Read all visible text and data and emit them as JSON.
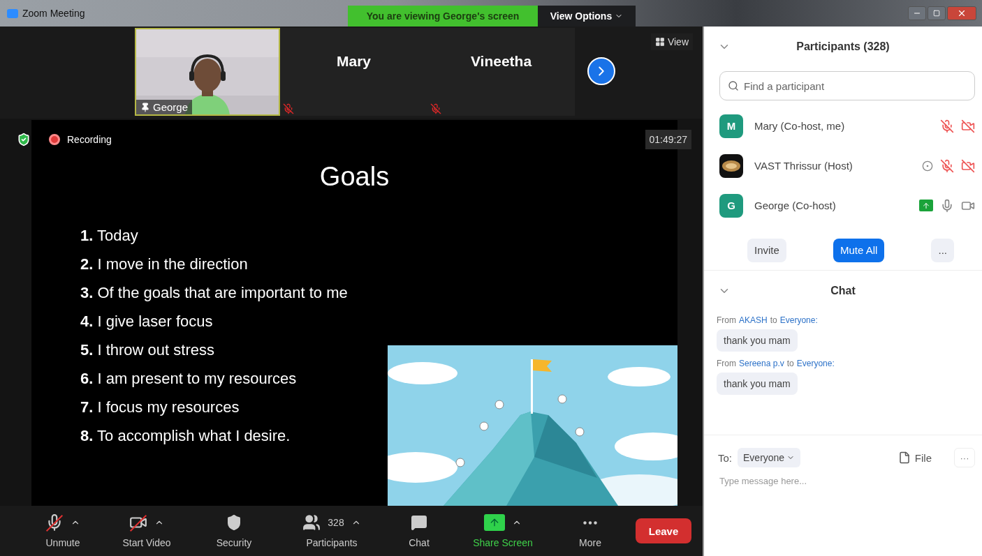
{
  "window": {
    "title": "Zoom Meeting"
  },
  "banner": {
    "text": "You are viewing George's screen",
    "view_options": "View Options"
  },
  "gallery": {
    "tiles": [
      {
        "kind": "video",
        "name": "George",
        "muted": false
      },
      {
        "kind": "name",
        "name": "Mary",
        "muted": true
      },
      {
        "kind": "name",
        "name": "Vineetha",
        "muted": true
      }
    ],
    "view_button": "View"
  },
  "share": {
    "recording_label": "Recording",
    "timer": "01:49:27",
    "slide": {
      "title": "Goals",
      "items": [
        "**1.** Today",
        "**2.** I move in the direction",
        "**3.** Of the goals that are important to me",
        "**4.** I give laser focus",
        "**5.** I throw out stress",
        "**6.** I am present to my resources",
        "**7.** I focus my resources",
        "**8.** To accomplish what I desire."
      ]
    }
  },
  "toolbar": [
    {
      "kind": "mic",
      "label": "Unmute",
      "caret": true,
      "off": true,
      "highlighted": false
    },
    {
      "kind": "video",
      "label": "Start Video",
      "caret": true,
      "off": true,
      "highlighted": false
    },
    {
      "kind": "security",
      "label": "Security",
      "caret": false,
      "off": false,
      "highlighted": false
    },
    {
      "kind": "participants",
      "label": "Participants",
      "count": "328",
      "caret": true,
      "off": false,
      "highlighted": false
    },
    {
      "kind": "chat",
      "label": "Chat",
      "caret": false,
      "off": false,
      "highlighted": false
    },
    {
      "kind": "share",
      "label": "Share Screen",
      "caret": true,
      "off": false,
      "highlighted": true
    },
    {
      "kind": "more",
      "label": "More",
      "caret": false,
      "off": false,
      "highlighted": false
    }
  ],
  "leave_button": "Leave",
  "participants_panel": {
    "title": "Participants (328)",
    "search": {
      "placeholder": "Find a participant"
    },
    "participants": [
      {
        "name": "Mary (Co-host, me)",
        "avatar": {
          "kind": "letter",
          "letter": "M"
        },
        "recording": false,
        "sharing": false,
        "muted": true,
        "video_off": true
      },
      {
        "name": "VAST Thrissur (Host)",
        "recording": true,
        "sharing": false,
        "muted": true,
        "video_off": true
      },
      {
        "name": "George (Co-host)",
        "avatar": {
          "kind": "letter",
          "letter": "G"
        },
        "recording": false,
        "sharing": true,
        "muted": false,
        "video_off": false
      }
    ],
    "buttons": [
      {
        "kind": "plain",
        "label": "Invite"
      },
      {
        "kind": "primary",
        "label": "Mute All"
      },
      {
        "kind": "more",
        "label": "..."
      }
    ]
  },
  "chat_panel": {
    "title": "Chat",
    "messages": [
      {
        "prefix": "From",
        "sender": "AKASH",
        "joiner": "to",
        "recipient": "Everyone:",
        "text": "thank you mam"
      },
      {
        "prefix": "From",
        "sender": "Sereena p.v",
        "joiner": "to",
        "recipient": "Everyone:",
        "text": "thank you mam"
      }
    ],
    "to_label": "To:",
    "recipient_select": "Everyone",
    "file_button": "File",
    "more_button": "···",
    "input": {
      "placeholder": "Type message here..."
    }
  }
}
